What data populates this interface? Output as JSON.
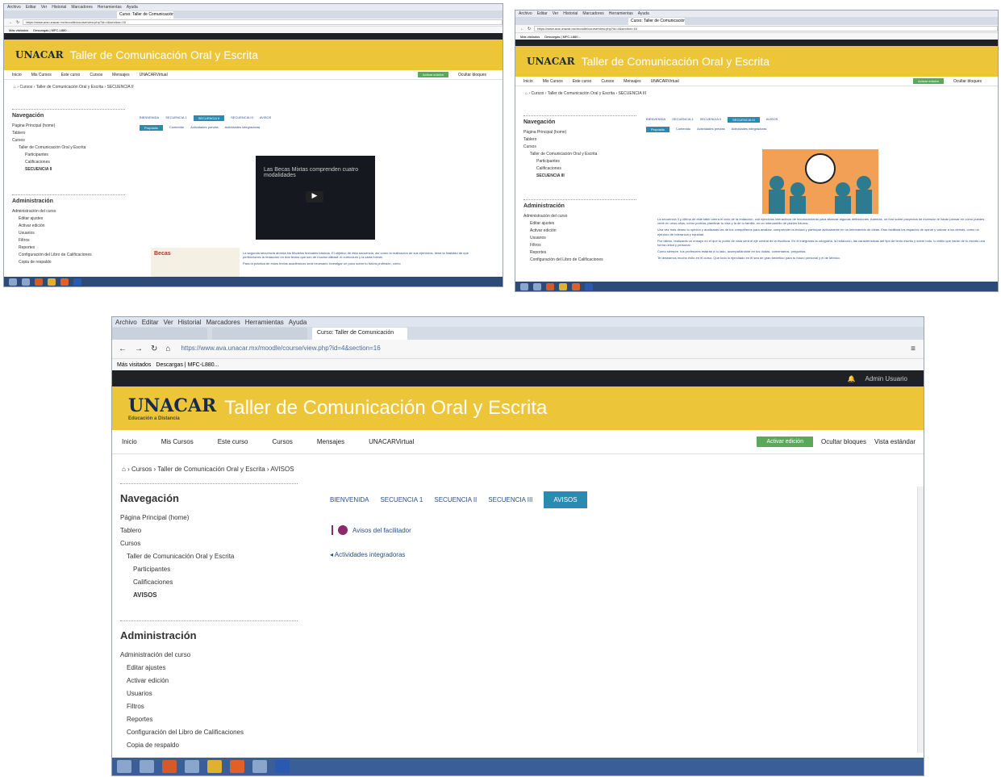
{
  "browser": {
    "menu": [
      "Archivo",
      "Editar",
      "Ver",
      "Historial",
      "Marcadores",
      "Herramientas",
      "Ayuda"
    ],
    "tab_current": "Curso: Taller de Comunicación",
    "url": "https://www.ava.unacar.mx/moodle/course/view.php?id=4&section=16",
    "bookmark_1": "Más visitados",
    "bookmark_2": "Descargas | MFC-L880..."
  },
  "site": {
    "logo": "UNACAR",
    "logo_sub": "Educación a Distancia",
    "course_title": "Taller de Comunicación Oral y Escrita",
    "user_name": "Admin Usuario"
  },
  "nav": {
    "inicio": "Inicio",
    "mis_cursos": "Mis Cursos",
    "este_curso": "Este curso",
    "cursos": "Cursos",
    "mensajes": "Mensajes",
    "unacarvirtual": "UNACARVirtual",
    "activar_edicion": "Activar edición",
    "ocultar_bloques": "Ocultar bloques",
    "vista_estandar": "Vista estándar"
  },
  "breadcrumb": {
    "cursos": "Cursos",
    "course": "Taller de Comunicación Oral y Escrita",
    "s1_current": "SECUENCIA II",
    "s2_current": "SECUENCIA III",
    "s3_current": "AVISOS"
  },
  "navigation_block": {
    "title": "Navegación",
    "home": "Página Principal (home)",
    "tablero": "Tablero",
    "cursos": "Cursos",
    "course": "Taller de Comunicación Oral y Escrita",
    "participantes": "Participantes",
    "calificaciones": "Calificaciones",
    "s1_section": "SECUENCIA II",
    "s2_section": "SECUENCIA III",
    "s3_section": "AVISOS"
  },
  "admin_block": {
    "title": "Administración",
    "admin_curso": "Administración del curso",
    "editar_ajustes": "Editar ajustes",
    "activar_edicion": "Activar edición",
    "usuarios": "Usuarios",
    "filtros": "Filtros",
    "reportes": "Reportes",
    "config_libro": "Configuración del Libro de Calificaciones",
    "copia": "Copia de respaldo"
  },
  "course_tabs": {
    "bienvenida": "BIENVENIDA",
    "sec1": "SECUENCIA 1",
    "sec2": "SECUENCIA II",
    "sec3": "SECUENCIA III",
    "avisos": "AVISOS"
  },
  "subtabs": {
    "proposito": "Propósito",
    "contenido": "Contenido",
    "actividades_previas": "Actividades previas",
    "actividades_integradoras": "Actividades integradoras"
  },
  "screen1": {
    "video_title": "Las Becas Mixtas comprenden cuatro modalidades",
    "becas": "Becas",
    "text_1": "La segunda secuencia aborda los Modelos textuales básicos. El objetivo de esta secuencia, así como la realización de sus ejercicios, tiene la finalidad de que perfecciones la redacción en dos textos que son de mucha utilidad: el curriculum y la carta formal.",
    "text_2": "Para la práctica de estos textos académicos será necesario investigar un poco sobre tu futura profesión, cómo"
  },
  "screen2": {
    "p1": "La secuencia 3 y última de este taller cierra el ciclo de la redacción, con ejercicios interactivos de reconocimiento para afianzar algunas definiciones. Además, un foro sobre proyectos de inversión te harán pensar en cómo puedes verte en unos años, cómo podrías planificar tu vida y la de tu familia, en un intercambio de planes futuros.",
    "p2": "Una vez más deseo tu opinión y analizarás las de tus compañeros para analizar, comprender la lectura y participar activamente en un intercambio de ideas. Esto facilitará los espacios de opinar y valorar a los demás, como un ejercicio de tolerancia y equidad.",
    "p3": "Por último, realizarás un ensayo en el que tu punto de vista será el eje central de la escritura. En él integrarás la ortografía, la redacción, las características del tipo de texto escrito y sobre todo, tu estilo que harán de tu escrito una forma única y personal.",
    "p4": "Como siempre, tus profesores estarán a tu lado, acompañándote en tus dudas, comentarios, preguntas.",
    "p5": "Te deseamos mucho éxito en el curso. Que todo lo ejercitado en él sea de gran beneficio para tu futuro personal y el de México."
  },
  "screen3": {
    "avisos_facilitador": "Avisos del facilitador",
    "actividades_link": "Actividades integradoras"
  },
  "colors": {
    "banner": "#ecc638",
    "accent_tab": "#2b8ab0",
    "green_button": "#5aa85a",
    "taskbar": "#3a5f98"
  }
}
